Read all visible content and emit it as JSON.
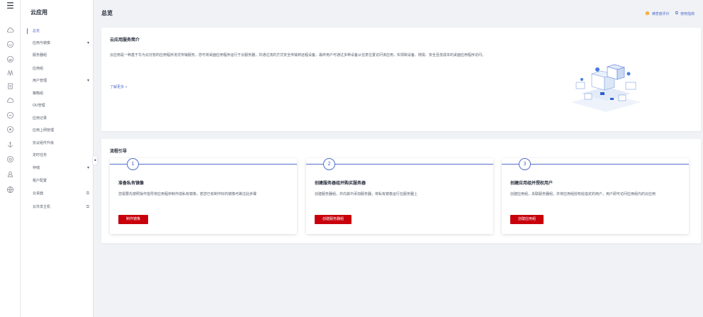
{
  "sidebar": {
    "title": "云应用",
    "items": [
      {
        "label": "总览"
      },
      {
        "label": "应用与镜像",
        "caret": "▾"
      },
      {
        "label": "服务器组"
      },
      {
        "label": "应用组"
      },
      {
        "label": "用户管理",
        "caret": "▾"
      },
      {
        "label": "策略组"
      },
      {
        "label": "OU管理"
      },
      {
        "label": "应用记录"
      },
      {
        "label": "应用上网管理"
      },
      {
        "label": "协议组件升级"
      },
      {
        "label": "定时任务"
      },
      {
        "label": "存储",
        "caret": "▾"
      },
      {
        "label": "租户配置"
      },
      {
        "label": "云桌面",
        "ext": "⧉"
      },
      {
        "label": "云共享主机",
        "ext": "⧉"
      }
    ],
    "collapse_glyph": "◂"
  },
  "rail": {
    "menu_glyph": "☰",
    "icons": [
      "cloud-icon",
      "cloud-icon",
      "cloud-icon",
      "network-icon",
      "document-icon",
      "cloud-icon",
      "cloud-icon",
      "cloud-icon",
      "anchor-icon",
      "settings-icon",
      "user-icon",
      "globe-icon"
    ]
  },
  "header": {
    "title": "总览",
    "feedback": "满意度评价",
    "guide": "使用指南",
    "feedback_glyph": "☻",
    "guide_glyph": "⧉"
  },
  "intro": {
    "title": "云应用服务简介",
    "description": "云应用是一种基于华为云托管的应用程序流式传输服务。您可将桌面应用程序运行于云服务器，并通过流的方式安全传输到远程设备，最终用户可通过多种设备从任意位置访问该应用，实现跨设备、随需、安全且低成本的桌面应用程序访问。",
    "learn_more": "了解更多 »"
  },
  "flow": {
    "title": "流程引导",
    "steps": [
      {
        "num": "1",
        "title": "准备私有镜像",
        "desc": "您需要先按照操作指导将应用程序制作成私有镜像，若您已有制作好的镜像可跳过此步骤",
        "button": "制作镜像"
      },
      {
        "num": "2",
        "title": "创建服务器组并购买服务器",
        "desc": "创建服务器组，并向其中添加服务器，将私有镜像运行在服务器上",
        "button": "创建服务器组"
      },
      {
        "num": "3",
        "title": "创建应用组并授权用户",
        "desc": "创建应用组，关联服务器组，并将应用组授权给指定的用户，用户即可访问应用组内的云应用",
        "button": "创建应用组"
      }
    ]
  },
  "colors": {
    "accent": "#526ecc",
    "primary_button": "#c7000b",
    "background": "#f0f2f5"
  }
}
